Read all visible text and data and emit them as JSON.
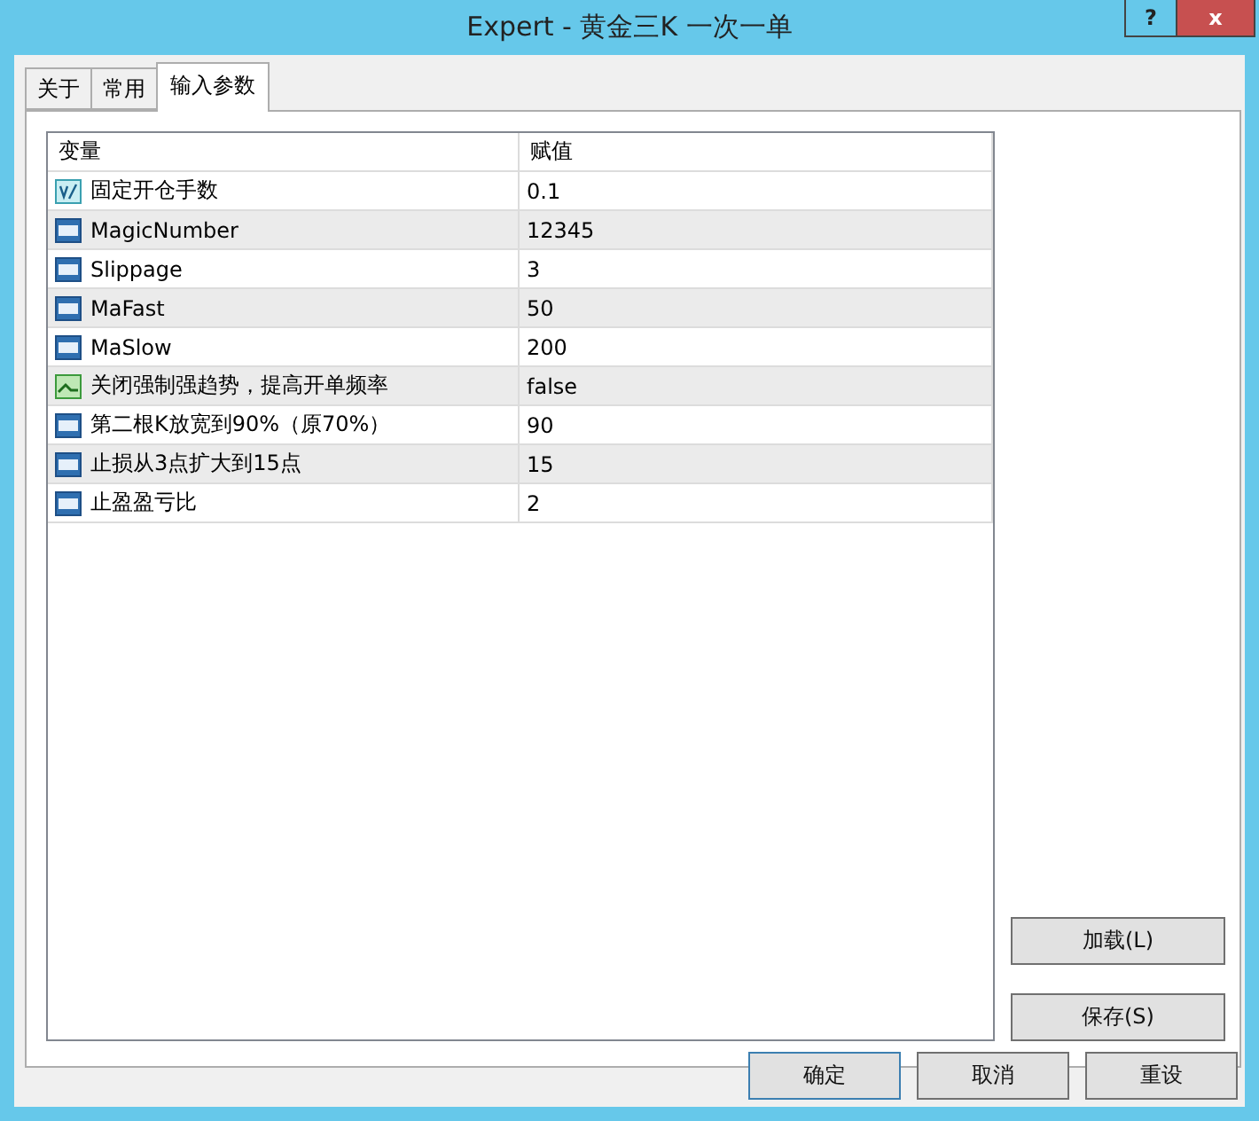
{
  "window": {
    "title": "Expert - 黄金三K 一次一单",
    "help": "?",
    "close": "x"
  },
  "tabs": [
    {
      "label": "关于",
      "selected": false
    },
    {
      "label": "常用",
      "selected": false
    },
    {
      "label": "输入参数",
      "selected": true
    }
  ],
  "table": {
    "columns": [
      "变量",
      "赋值"
    ],
    "rows": [
      {
        "kind": "double",
        "name": "固定开仓手数",
        "value": "0.1"
      },
      {
        "kind": "int",
        "name": "MagicNumber",
        "value": "12345"
      },
      {
        "kind": "int",
        "name": "Slippage",
        "value": "3"
      },
      {
        "kind": "int",
        "name": "MaFast",
        "value": "50"
      },
      {
        "kind": "int",
        "name": "MaSlow",
        "value": "200"
      },
      {
        "kind": "bool",
        "name": "关闭强制强趋势，提高开单频率",
        "value": "false"
      },
      {
        "kind": "int",
        "name": "第二根K放宽到90%（原70%）",
        "value": "90"
      },
      {
        "kind": "int",
        "name": "止损从3点扩大到15点",
        "value": "15"
      },
      {
        "kind": "int",
        "name": "止盈盈亏比",
        "value": "2"
      }
    ]
  },
  "side_buttons": [
    "加载(L)",
    "保存(S)"
  ],
  "buttons": [
    {
      "label": "确定",
      "default": true
    },
    {
      "label": "取消",
      "default": false
    },
    {
      "label": "重设",
      "default": false
    }
  ]
}
